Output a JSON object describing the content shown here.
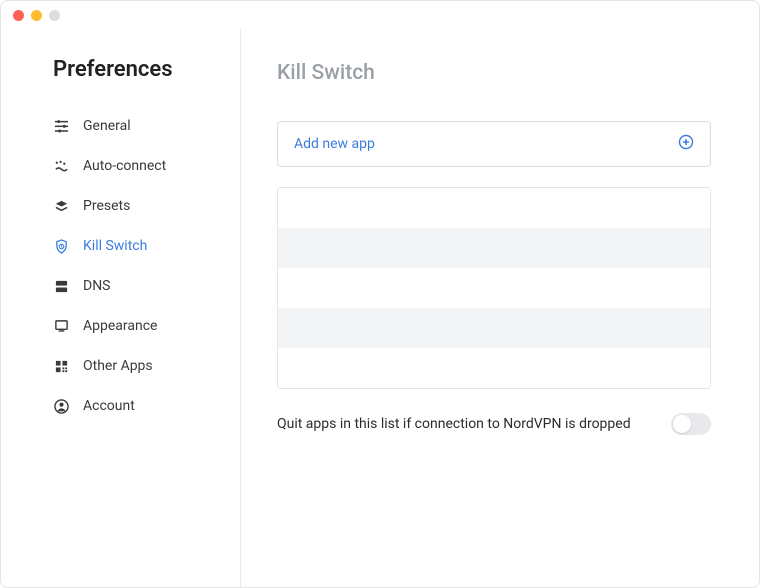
{
  "sidebar": {
    "title": "Preferences",
    "items": [
      {
        "label": "General"
      },
      {
        "label": "Auto-connect"
      },
      {
        "label": "Presets"
      },
      {
        "label": "Kill Switch"
      },
      {
        "label": "DNS"
      },
      {
        "label": "Appearance"
      },
      {
        "label": "Other Apps"
      },
      {
        "label": "Account"
      }
    ]
  },
  "main": {
    "title": "Kill Switch",
    "add_new_app_label": "Add new app",
    "quit_toggle_label": "Quit apps in this list if connection to NordVPN is dropped"
  }
}
